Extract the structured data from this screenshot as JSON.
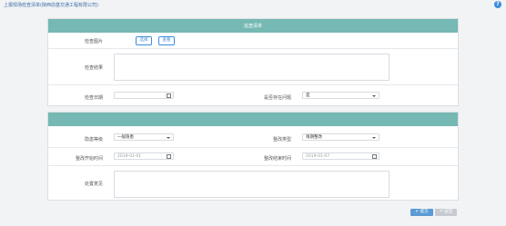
{
  "header": {
    "title": "上报现场检查清单(陕西前基交通工程有限公司)",
    "help_icon": "?"
  },
  "panel1": {
    "title": "巡查清单",
    "check_image_label": "检查图片",
    "upload_button": "选择",
    "view_button": "查看",
    "check_result_label": "检查结果",
    "check_date_label": "检查日期",
    "check_date_value": "",
    "has_problem_label": "是否存在问题",
    "has_problem_value": "是"
  },
  "panel2": {
    "title": "",
    "hazard_level_label": "隐患等级",
    "hazard_level_value": "一般隐患",
    "rectify_type_label": "整改类型",
    "rectify_type_value": "限期整改",
    "rectify_start_label": "整改开始时间",
    "rectify_start_placeholder": "2019-01-01",
    "rectify_end_label": "整改结束时间",
    "rectify_end_placeholder": "2019-01-07",
    "remark_label": "处置意见"
  },
  "footer": {
    "submit_label": "✔ 提交",
    "back_label": "↶ 返回"
  },
  "colors": {
    "panel_header": "#76b8b3",
    "accent": "#3c8dde",
    "submit": "#5b9bd5",
    "back": "#c7cbd1"
  }
}
